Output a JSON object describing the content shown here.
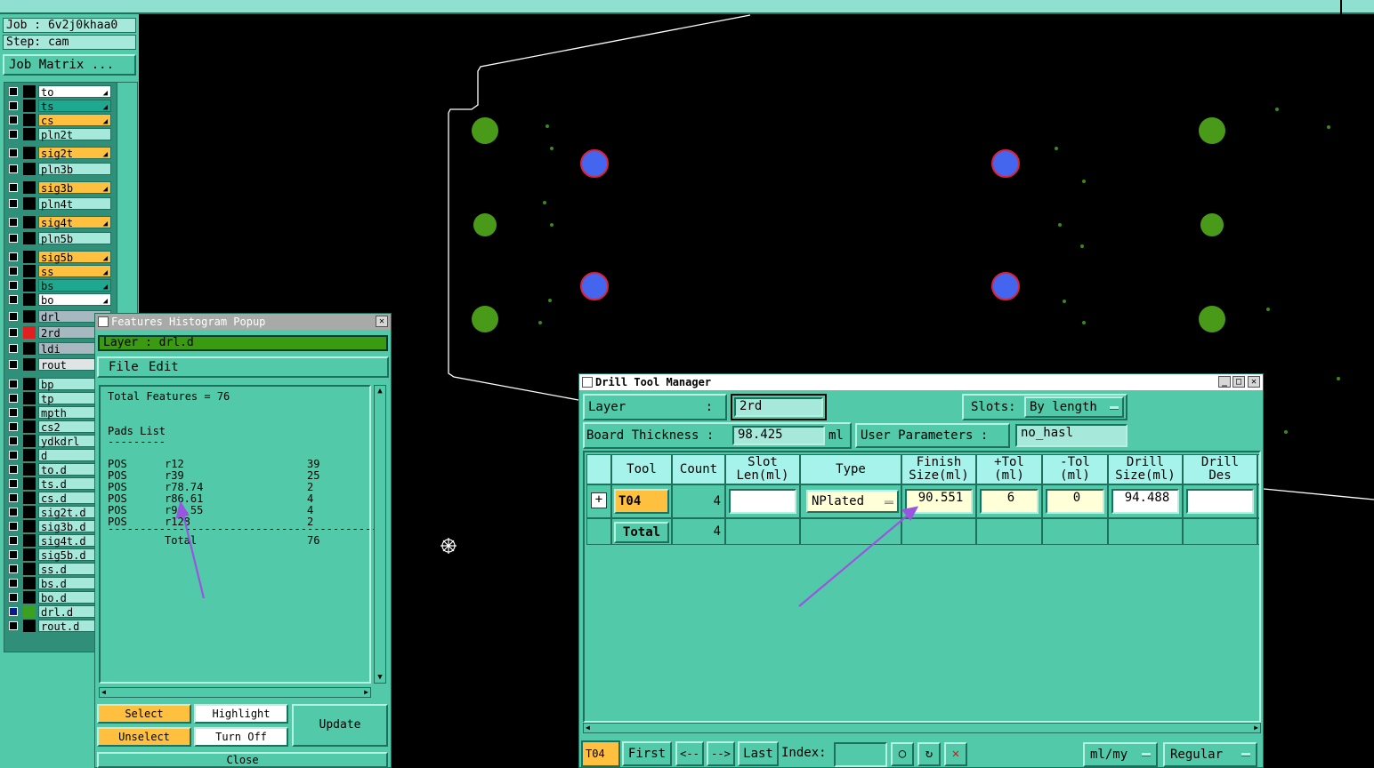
{
  "left_panel": {
    "job": "Job : 6v2j0khaa0",
    "step": "Step: cam",
    "job_matrix_button": "Job Matrix ...",
    "layers": [
      {
        "name": "to",
        "color": "#ffffff",
        "mark": true,
        "affected": false
      },
      {
        "name": "ts",
        "color": "#1fa890",
        "mark": true,
        "affected": false
      },
      {
        "name": "cs",
        "color": "#ffc040",
        "mark": true,
        "affected": false
      },
      {
        "name": "pln2t",
        "color": "#a6e8da",
        "mark": false,
        "affected": false
      },
      {
        "name": "sig2t",
        "color": "#ffc040",
        "mark": true,
        "affected": false
      },
      {
        "name": "pln3b",
        "color": "#a6e8da",
        "mark": false,
        "affected": false
      },
      {
        "name": "sig3b",
        "color": "#ffc040",
        "mark": true,
        "affected": false
      },
      {
        "name": "pln4t",
        "color": "#a6e8da",
        "mark": false,
        "affected": false
      },
      {
        "name": "sig4t",
        "color": "#ffc040",
        "mark": true,
        "affected": false
      },
      {
        "name": "pln5b",
        "color": "#a6e8da",
        "mark": false,
        "affected": false
      },
      {
        "name": "sig5b",
        "color": "#ffc040",
        "mark": true,
        "affected": false
      },
      {
        "name": "ss",
        "color": "#ffc040",
        "mark": true,
        "affected": false
      },
      {
        "name": "bs",
        "color": "#1fa890",
        "mark": true,
        "affected": false
      },
      {
        "name": "bo",
        "color": "#ffffff",
        "mark": true,
        "affected": false
      },
      {
        "name": "drl",
        "color": "#a8b8c0",
        "mark": false,
        "affected": false
      },
      {
        "name": "2rd",
        "color": "#a8b8c0",
        "mark": false,
        "affected": "red"
      },
      {
        "name": "ldi",
        "color": "#a8b8c0",
        "mark": false,
        "affected": false
      },
      {
        "name": "rout",
        "color": "#e0e4e4",
        "mark": false,
        "affected": false
      },
      {
        "name": "bp",
        "color": "#a6e8da",
        "mark": false,
        "affected": false
      },
      {
        "name": "tp",
        "color": "#a6e8da",
        "mark": false,
        "affected": false
      },
      {
        "name": "mpth",
        "color": "#a6e8da",
        "mark": false,
        "affected": false
      },
      {
        "name": "cs2",
        "color": "#a6e8da",
        "mark": false,
        "affected": false
      },
      {
        "name": "ydkdrl",
        "color": "#a6e8da",
        "mark": false,
        "affected": false
      },
      {
        "name": "d",
        "color": "#a6e8da",
        "mark": false,
        "affected": false
      },
      {
        "name": "to.d",
        "color": "#a6e8da",
        "mark": false,
        "affected": false
      },
      {
        "name": "ts.d",
        "color": "#a6e8da",
        "mark": false,
        "affected": false
      },
      {
        "name": "cs.d",
        "color": "#a6e8da",
        "mark": false,
        "affected": false
      },
      {
        "name": "sig2t.d",
        "color": "#a6e8da",
        "mark": false,
        "affected": false
      },
      {
        "name": "sig3b.d",
        "color": "#a6e8da",
        "mark": false,
        "affected": false
      },
      {
        "name": "sig4t.d",
        "color": "#a6e8da",
        "mark": false,
        "affected": false
      },
      {
        "name": "sig5b.d",
        "color": "#a6e8da",
        "mark": false,
        "affected": false
      },
      {
        "name": "ss.d",
        "color": "#a6e8da",
        "mark": false,
        "affected": false
      },
      {
        "name": "bs.d",
        "color": "#a6e8da",
        "mark": false,
        "affected": false
      },
      {
        "name": "bo.d",
        "color": "#a6e8da",
        "mark": false,
        "affected": false
      },
      {
        "name": "drl.d",
        "color": "#a6e8da",
        "mark": false,
        "affected": "green",
        "selected": true
      },
      {
        "name": "rout.d",
        "color": "#a6e8da",
        "mark": false,
        "affected": false
      }
    ]
  },
  "histogram": {
    "title": "Features Histogram Popup",
    "layer_label": "Layer :  drl.d",
    "menu": {
      "file": "File",
      "edit": "Edit"
    },
    "total_line": "Total Features = 76",
    "pads_title": "Pads List",
    "pads_rule": "---------",
    "rows": [
      {
        "pol": "POS",
        "sym": "r12",
        "count": "39"
      },
      {
        "pol": "POS",
        "sym": "r39",
        "count": "25"
      },
      {
        "pol": "POS",
        "sym": "r78.74",
        "count": "2"
      },
      {
        "pol": "POS",
        "sym": "r86.61",
        "count": "4"
      },
      {
        "pol": "POS",
        "sym": "r90.55",
        "count": "4"
      },
      {
        "pol": "POS",
        "sym": "r128",
        "count": "2"
      }
    ],
    "separator": "------------------------------------------",
    "total_label": "Total",
    "total_value": "76",
    "buttons": {
      "select": "Select",
      "highlight": "Highlight",
      "unselect": "Unselect",
      "turn_off": "Turn Off",
      "update": "Update",
      "close": "Close"
    }
  },
  "drill_tool_manager": {
    "title": "Drill Tool Manager",
    "layer_label": "Layer",
    "layer_colon": ":",
    "layer_value": "2rd",
    "slots_label": "Slots:",
    "slots_value": "By length",
    "board_thickness_label": "Board Thickness :",
    "board_thickness_value": "98.425",
    "board_thickness_unit": "ml",
    "user_params_button": "User Parameters :",
    "user_params_value": "no_hasl",
    "columns": [
      {
        "l1": "Tool",
        "l2": ""
      },
      {
        "l1": "Count",
        "l2": ""
      },
      {
        "l1": "Slot",
        "l2": "Len(ml)"
      },
      {
        "l1": "Type",
        "l2": ""
      },
      {
        "l1": "Finish",
        "l2": "Size(ml)"
      },
      {
        "l1": "+Tol",
        "l2": "(ml)"
      },
      {
        "l1": "-Tol",
        "l2": "(ml)"
      },
      {
        "l1": "Drill",
        "l2": "Size(ml)"
      },
      {
        "l1": "Drill",
        "l2": "Des"
      }
    ],
    "row": {
      "tool": "T04",
      "count": "4",
      "slot_len": "",
      "type": "NPlated",
      "finish": "90.551",
      "plus_tol": "6",
      "minus_tol": "0",
      "drill_size": "94.488",
      "drill_des": ""
    },
    "total_row": {
      "label": "Total",
      "count": "4"
    },
    "bottom": {
      "current_tool": "T04",
      "first": "First",
      "prev": "<--",
      "next": "-->",
      "last": "Last",
      "index_label": "Index:",
      "units": "ml/my",
      "mode": "Regular"
    }
  }
}
